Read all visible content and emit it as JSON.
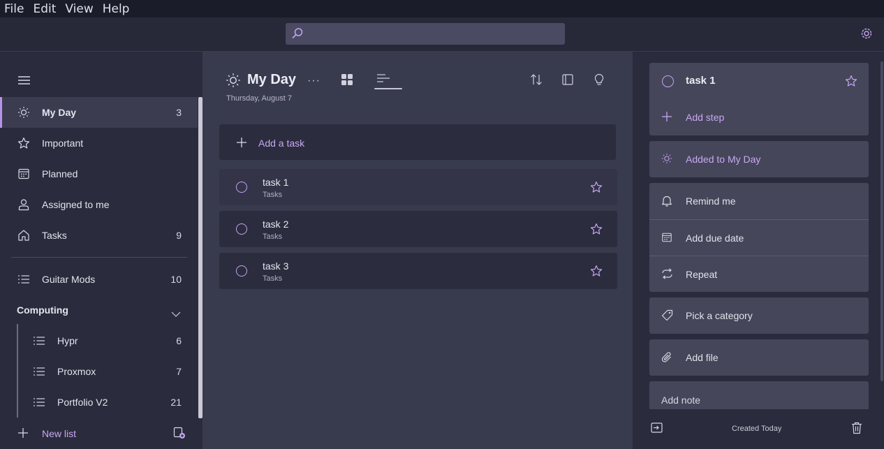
{
  "menu": [
    "File",
    "Edit",
    "View",
    "Help"
  ],
  "search": {
    "placeholder": ""
  },
  "sidebar": {
    "items": [
      {
        "label": "My Day",
        "count": "3",
        "icon": "sun-icon"
      },
      {
        "label": "Important",
        "count": "",
        "icon": "star-icon"
      },
      {
        "label": "Planned",
        "count": "",
        "icon": "calendar-icon"
      },
      {
        "label": "Assigned to me",
        "count": "",
        "icon": "person-icon"
      },
      {
        "label": "Tasks",
        "count": "9",
        "icon": "home-icon"
      }
    ],
    "lists": [
      {
        "label": "Guitar Mods",
        "count": "10"
      }
    ],
    "group": {
      "label": "Computing",
      "items": [
        {
          "label": "Hypr",
          "count": "6"
        },
        {
          "label": "Proxmox",
          "count": "7"
        },
        {
          "label": "Portfolio V2",
          "count": "21"
        }
      ]
    },
    "new_list": "New list"
  },
  "main": {
    "title": "My Day",
    "date": "Thursday, August 7",
    "more": "···",
    "add_task": "Add a task",
    "tasks": [
      {
        "name": "task 1",
        "list": "Tasks"
      },
      {
        "name": "task 2",
        "list": "Tasks"
      },
      {
        "name": "task 3",
        "list": "Tasks"
      }
    ]
  },
  "detail": {
    "title": "task 1",
    "add_step": "Add step",
    "added_to_my_day": "Added to My Day",
    "remind_me": "Remind me",
    "add_due_date": "Add due date",
    "repeat": "Repeat",
    "pick_category": "Pick a category",
    "add_file": "Add file",
    "add_note": "Add note",
    "created": "Created Today"
  },
  "colors": {
    "accent": "#c9a8f3",
    "sidebar_bg": "#2a2b3c",
    "main_bg": "#383a4e"
  }
}
